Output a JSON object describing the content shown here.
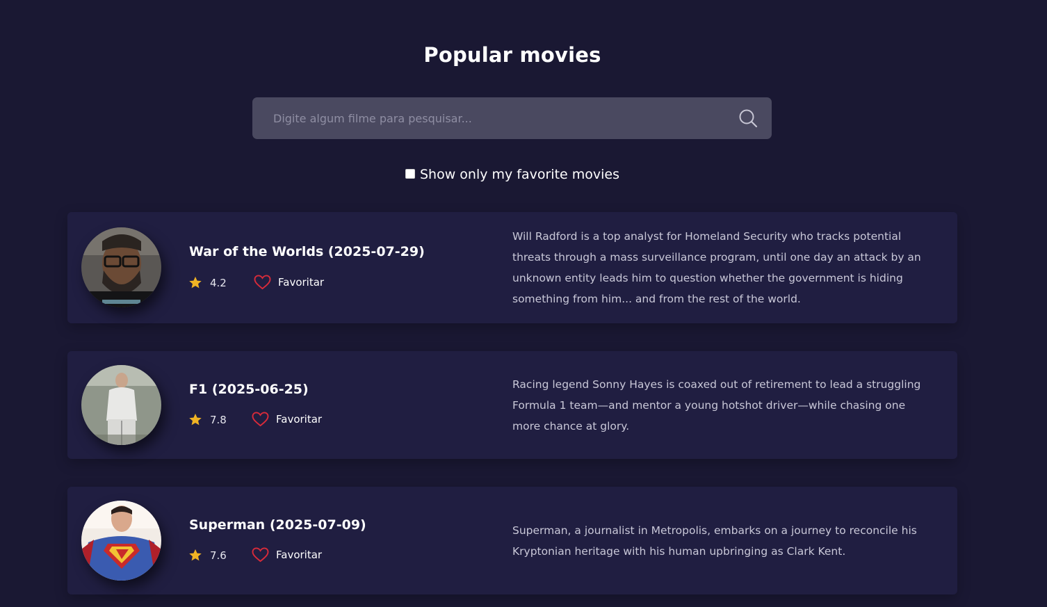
{
  "page": {
    "title": "Popular movies"
  },
  "search": {
    "placeholder": "Digite algum filme para pesquisar...",
    "icon": "search-icon"
  },
  "filter": {
    "label": "Show only my favorite movies",
    "checked": false
  },
  "colors": {
    "background": "#1a1833",
    "card": "#201e41",
    "search_bg": "#4a4960",
    "star": "#f0b324",
    "heart": "#d92b3a"
  },
  "movies": [
    {
      "title": "War of the Worlds (2025-07-29)",
      "rating": "4.2",
      "favorite_label": "Favoritar",
      "favorited": false,
      "overview": "Will Radford is a top analyst for Homeland Security who tracks potential threats through a mass surveillance program, until one day an attack by an unknown entity leads him to question whether the government is hiding something from him... and from the rest of the world."
    },
    {
      "title": "F1 (2025-06-25)",
      "rating": "7.8",
      "favorite_label": "Favoritar",
      "favorited": false,
      "overview": "Racing legend Sonny Hayes is coaxed out of retirement to lead a struggling Formula 1 team—and mentor a young hotshot driver—while chasing one more chance at glory."
    },
    {
      "title": "Superman (2025-07-09)",
      "rating": "7.6",
      "favorite_label": "Favoritar",
      "favorited": false,
      "overview": "Superman, a journalist in Metropolis, embarks on a journey to reconcile his Kryptonian heritage with his human upbringing as Clark Kent."
    }
  ]
}
